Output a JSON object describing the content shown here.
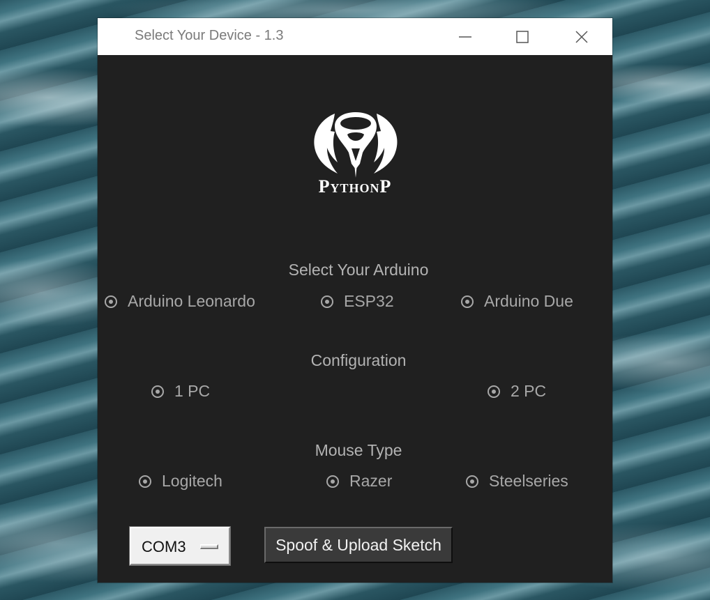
{
  "window": {
    "title": "Select Your Device - 1.3"
  },
  "logo": {
    "icon": "cobra-logo-icon",
    "brand": "PythonP"
  },
  "arduino": {
    "label": "Select Your Arduino",
    "options": [
      "Arduino Leonardo",
      "ESP32",
      "Arduino Due"
    ]
  },
  "configuration": {
    "label": "Configuration",
    "options": [
      "1 PC",
      "2 PC"
    ]
  },
  "mouse": {
    "label": "Mouse Type",
    "options": [
      "Logitech",
      "Razer",
      "Steelseries"
    ]
  },
  "port": {
    "selected": "COM3"
  },
  "actions": {
    "upload_label": "Spoof & Upload Sketch"
  },
  "colors": {
    "window_bg": "#202020",
    "titlebar_bg": "#ffffff",
    "text_muted": "#a8a8a8",
    "button_bg": "#3a3a3a"
  }
}
